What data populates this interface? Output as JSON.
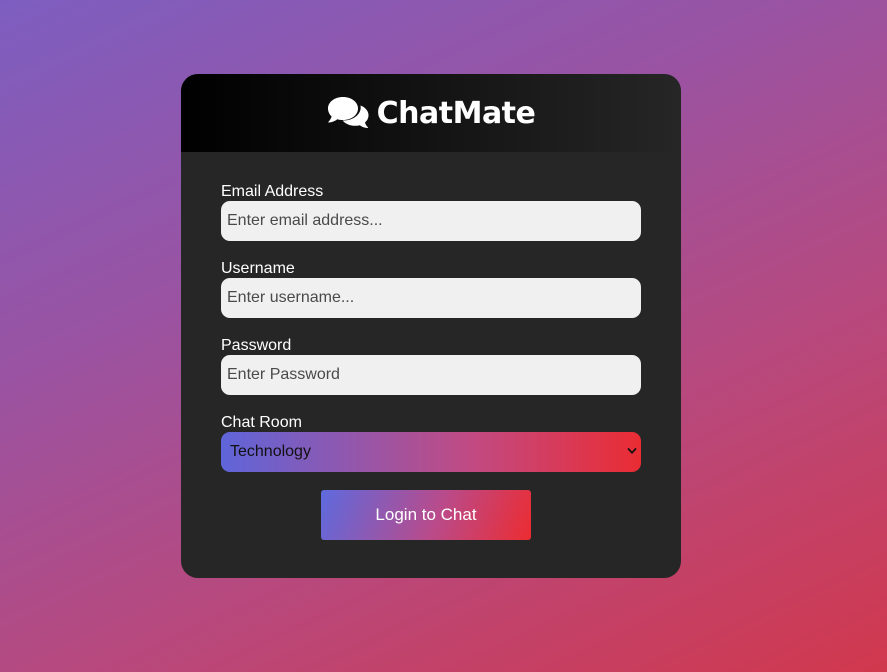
{
  "app": {
    "title": "ChatMate",
    "logo_icon": "comments-icon"
  },
  "form": {
    "email": {
      "label": "Email Address",
      "placeholder": "Enter email address...",
      "value": ""
    },
    "username": {
      "label": "Username",
      "placeholder": "Enter username...",
      "value": ""
    },
    "password": {
      "label": "Password",
      "placeholder": "Enter Password",
      "value": ""
    },
    "room": {
      "label": "Chat Room",
      "selected": "Technology"
    },
    "submit_label": "Login to Chat"
  },
  "colors": {
    "card_bg": "#262626",
    "input_bg": "#f0f0f0",
    "accent_start": "#5f65d9",
    "accent_end": "#ea2c33"
  }
}
